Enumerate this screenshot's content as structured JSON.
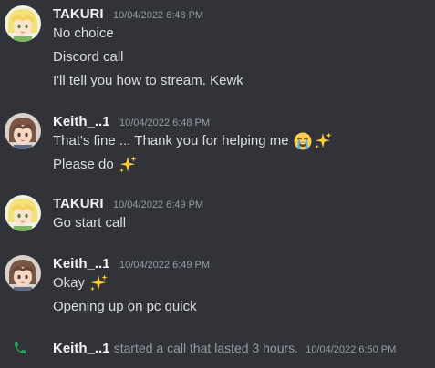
{
  "colors": {
    "background": "#313338",
    "username": "#f2f3f5",
    "text": "#dbdee1",
    "muted": "#949ba4",
    "call_green": "#23a55a"
  },
  "messages": [
    {
      "username": "TAKURI",
      "timestamp": "10/04/2022 6:48 PM",
      "avatar": "blonde-anime-character-avatar",
      "lines": [
        "No choice",
        "Discord call",
        "I'll tell you how to stream. Kewk"
      ]
    },
    {
      "username": "Keith_..1",
      "timestamp": "10/04/2022 6:48 PM",
      "avatar": "brown-haired-anime-character-avatar",
      "lines": [
        "That's fine ... Thank you for helping me",
        "Please do"
      ]
    },
    {
      "username": "TAKURI",
      "timestamp": "10/04/2022 6:49 PM",
      "avatar": "blonde-anime-character-avatar",
      "lines": [
        "Go start call"
      ]
    },
    {
      "username": "Keith_..1",
      "timestamp": "10/04/2022 6:49 PM",
      "avatar": "brown-haired-anime-character-avatar",
      "lines": [
        "Okay",
        "Opening up on pc quick"
      ]
    }
  ],
  "call_event": {
    "icon": "phone-icon",
    "username": "Keith_..1",
    "description": "started a call that lasted 3 hours.",
    "timestamp": "10/04/2022 6:50 PM"
  }
}
